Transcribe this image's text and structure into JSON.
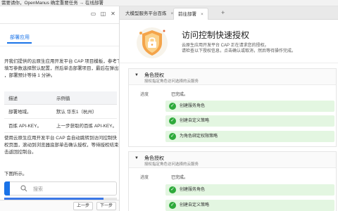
{
  "notification": {
    "text": "需要请你，OpenManus 确定重要任务 → 在线部署"
  },
  "left": {
    "tab": "部署应用",
    "intro_lines": [
      "开我们提供的云原生应用开发平台 CAP 项目模板，参考下",
      "填写参数选择默认配置，然后单击部署项目，最后在弹出",
      "，部署预计等待 1 分钟。"
    ],
    "table": {
      "headers": [
        "描述",
        "示例值"
      ],
      "rows": [
        [
          "部署地域。",
          "默认 华东1（杭州）"
        ],
        [
          "百炼 API-KEY。",
          "上一步获取的百炼 API-KEY。"
        ]
      ]
    },
    "note_lines": [
      "使用云原生应用开发平台 CAP 会自动跳转到访问控制快",
      "权页面，滚动到浏览器底部单击确认授权，等待授权结束",
      "击返回控制台。"
    ],
    "see_fig": "下图所示。",
    "search_placeholder": "搜索",
    "progress_value": 0.88,
    "prev_label": "上一步",
    "next_label": "下一步",
    "accent": "#1a73e8"
  },
  "browser": {
    "tabs": [
      {
        "label": "大模型服务平台百炼",
        "active": false
      },
      {
        "label": "前往部署",
        "active": true
      }
    ],
    "new_tab": "+",
    "close": "×"
  },
  "page": {
    "title": "访问控制快速授权",
    "subtitle_lines": [
      "云原生应用开发平台 CAP 正在请求您的授权。",
      "请检查以下授权信息，点击确认或取消，然后等待操作完成。"
    ],
    "sections": [
      {
        "title": "角色授权",
        "desc": "授权指定角色访问选择的云服务",
        "progress_label": "进度",
        "state": "已完成。",
        "steps": [
          "创建服务角色",
          "创建自定义策略",
          "为角色绑定权限策略"
        ]
      },
      {
        "title": "角色授权",
        "desc": "授权指定角色访问选择的云服务",
        "progress_label": "进度",
        "state": "已完成。",
        "steps": [
          "创建服务角色",
          "创建自定义策略",
          "为角色绑定权限策略"
        ]
      }
    ],
    "success_color": "#2eaa3b",
    "step_bg": "#e3f6e1"
  }
}
